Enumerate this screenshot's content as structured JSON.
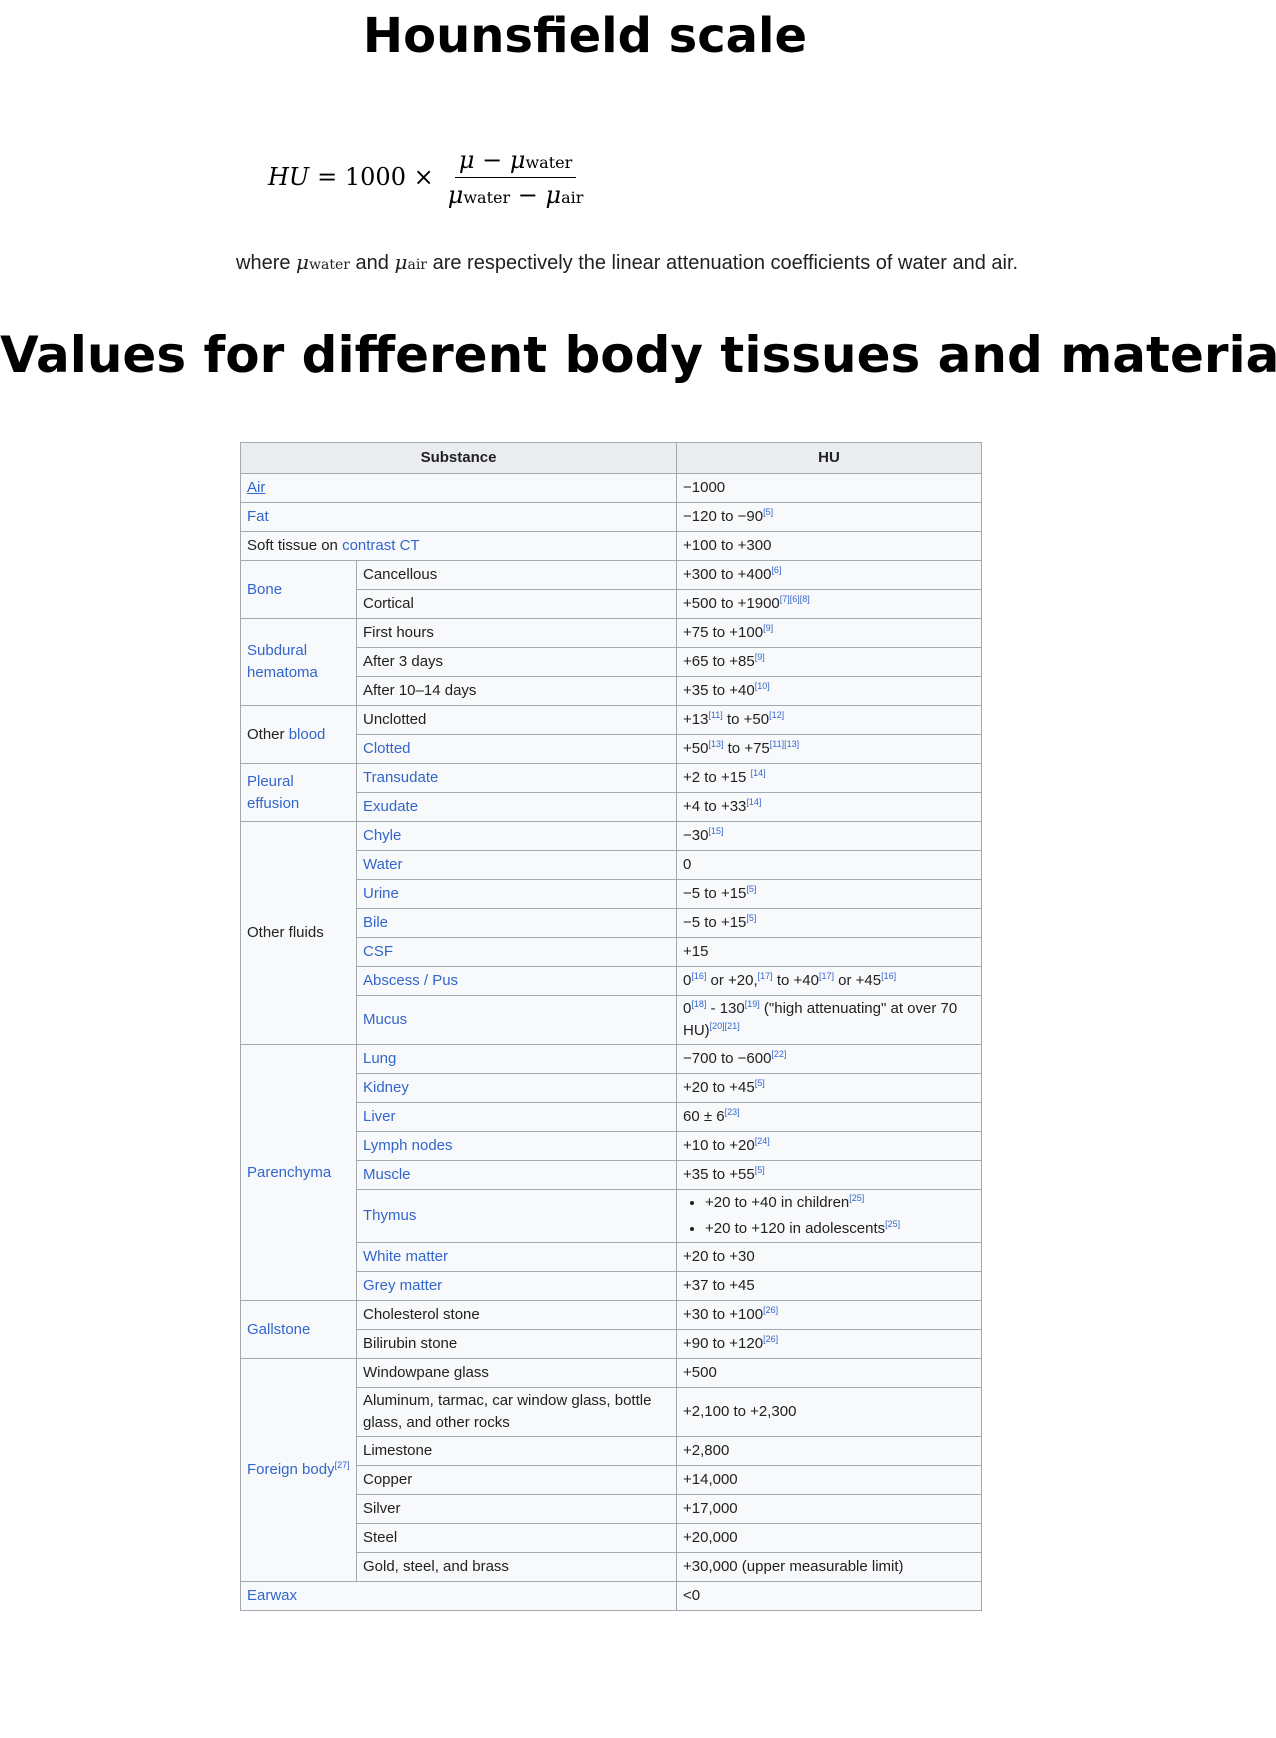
{
  "page": {
    "title": "Hounsfield scale",
    "formula": {
      "lhs": "HU",
      "equals": "= 1000 ×",
      "num_mu": "μ",
      "minus": "−",
      "water": "water",
      "air": "air"
    },
    "where": {
      "w1": "where",
      "w2": "and",
      "w3": "are respectively the linear attenuation coefficients of water and air."
    },
    "section_title": "Values for different body tissues and material"
  },
  "table": {
    "headers": [
      "Substance",
      "HU"
    ],
    "r_air": {
      "name": "Air",
      "hu": "−1000"
    },
    "r_fat": {
      "name": "Fat",
      "hu": "−120 to −90",
      "ref": "[5]"
    },
    "r_soft": {
      "name_a": "Soft tissue on ",
      "name_b": "contrast CT",
      "hu": "+100 to +300"
    },
    "bone": {
      "group": "Bone",
      "canc": {
        "name": "Cancellous",
        "hu": "+300 to +400",
        "ref": "[6]"
      },
      "cort": {
        "name": "Cortical",
        "hu": "+500 to +1900",
        "ref": "[7][6][8]"
      }
    },
    "subdural": {
      "group": "Subdural hematoma",
      "r1": {
        "name": "First hours",
        "hu": "+75 to +100",
        "ref": "[9]"
      },
      "r2": {
        "name": "After 3 days",
        "hu": "+65 to +85",
        "ref": "[9]"
      },
      "r3": {
        "name": "After 10–14 days",
        "hu": "+35 to +40",
        "ref": "[10]"
      }
    },
    "blood": {
      "group_a": "Other ",
      "group_b": "blood",
      "r1": {
        "name": "Unclotted",
        "hu_a": "+13",
        "ref_a": "[11]",
        "hu_b": " to +50",
        "ref_b": "[12]"
      },
      "r2": {
        "name": "Clotted",
        "hu_a": "+50",
        "ref_a": "[13]",
        "hu_b": " to +75",
        "ref_b": "[11][13]"
      }
    },
    "pleural": {
      "group": "Pleural effusion",
      "r1": {
        "name": "Transudate",
        "hu": "+2 to +15 ",
        "ref": "[14]"
      },
      "r2": {
        "name": "Exudate",
        "hu": "+4 to +33",
        "ref": "[14]"
      }
    },
    "fluids": {
      "group": "Other fluids",
      "chyle": {
        "name": "Chyle",
        "hu": "−30",
        "ref": "[15]"
      },
      "water": {
        "name": "Water",
        "hu": "0"
      },
      "urine": {
        "name": "Urine",
        "hu": "−5 to +15",
        "ref": "[5]"
      },
      "bile": {
        "name": "Bile",
        "hu": "−5 to +15",
        "ref": "[5]"
      },
      "csf": {
        "name": "CSF",
        "hu": "+15"
      },
      "abscess": {
        "name": "Abscess / Pus",
        "p1": "0",
        "r1": "[16]",
        "p2": " or +20,",
        "r2": "[17]",
        "p3": " to +40",
        "r3": "[17]",
        "p4": " or +45",
        "r4": "[16]"
      },
      "mucus": {
        "name": "Mucus",
        "p1": "0",
        "r1": "[18]",
        "p2": " - 130",
        "r2": "[19]",
        "p3": " (\"high attenuating\" at over 70 HU)",
        "r3": "[20][21]"
      }
    },
    "parenchyma": {
      "group": "Parenchyma",
      "lung": {
        "name": "Lung",
        "hu": "−700 to −600",
        "ref": "[22]"
      },
      "kidney": {
        "name": "Kidney",
        "hu": "+20 to +45",
        "ref": "[5]"
      },
      "liver": {
        "name": "Liver",
        "hu": "60 ± 6",
        "ref": "[23]"
      },
      "lymph": {
        "name": "Lymph nodes",
        "hu": "+10 to +20",
        "ref": "[24]"
      },
      "muscle": {
        "name": "Muscle",
        "hu": "+35 to +55",
        "ref": "[5]"
      },
      "thymus": {
        "name": "Thymus",
        "b1": "+20 to +40 in children",
        "b1ref": "[25]",
        "b2": "+20 to +120 in adolescents",
        "b2ref": "[25]"
      },
      "white": {
        "name": "White matter",
        "hu": "+20 to +30"
      },
      "grey": {
        "name": "Grey matter",
        "hu": "+37 to +45"
      }
    },
    "gallstone": {
      "group": "Gallstone",
      "r1": {
        "name": "Cholesterol stone",
        "hu": "+30 to +100",
        "ref": "[26]"
      },
      "r2": {
        "name": "Bilirubin stone",
        "hu": "+90 to +120",
        "ref": "[26]"
      }
    },
    "foreign": {
      "group": "Foreign body",
      "ref": "[27]",
      "r1": {
        "name": "Windowpane glass",
        "hu": "+500"
      },
      "r2": {
        "name": "Aluminum, tarmac, car window glass, bottle glass, and other rocks",
        "hu": "+2,100 to +2,300"
      },
      "r3": {
        "name": "Limestone",
        "hu": "+2,800"
      },
      "r4": {
        "name": "Copper",
        "hu": "+14,000"
      },
      "r5": {
        "name": "Silver",
        "hu": "+17,000"
      },
      "r6": {
        "name": "Steel",
        "hu": "+20,000"
      },
      "r7": {
        "name": "Gold, steel, and brass",
        "hu": "+30,000 (upper measurable limit)"
      }
    },
    "r_earwax": {
      "name": "Earwax",
      "hu": "<0"
    }
  }
}
